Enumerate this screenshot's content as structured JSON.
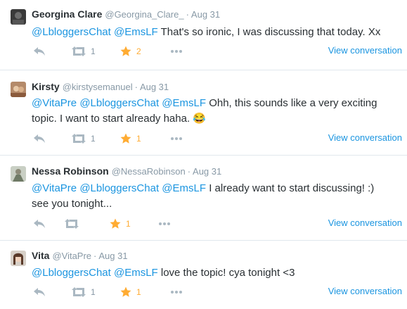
{
  "colors": {
    "link": "#1b95e0",
    "meta": "#8899a6",
    "text": "#292f33",
    "star": "#ffac33",
    "divider": "#e1e8ed"
  },
  "tweets": [
    {
      "name": "Georgina Clare",
      "handle": "@Georgina_Clare_",
      "dot": "·",
      "date": "Aug 31",
      "mentions": [
        "@LbloggersChat",
        "@EmsLF"
      ],
      "body": "That's so ironic, I was discussing that today. Xx",
      "retweets": "1",
      "favorites": "2",
      "view": "View conversation",
      "icons": {
        "reply": "reply-icon",
        "retweet": "retweet-icon",
        "favorite": "star-icon",
        "more": "more-icon"
      }
    },
    {
      "name": "Kirsty",
      "handle": "@kirstysemanuel",
      "dot": "·",
      "date": "Aug 31",
      "mentions": [
        "@VitaPre",
        "@LbloggersChat",
        "@EmsLF"
      ],
      "body_line1": "Ohh, this sounds like a very exciting",
      "body_line2": "topic. I want to start already haha. 😂",
      "retweets": "1",
      "favorites": "1",
      "view": "View conversation",
      "icons": {
        "reply": "reply-icon",
        "retweet": "retweet-icon",
        "favorite": "star-icon",
        "more": "more-icon"
      }
    },
    {
      "name": "Nessa Robinson",
      "handle": "@NessaRobinson",
      "dot": "·",
      "date": "Aug 31",
      "mentions": [
        "@VitaPre",
        "@LbloggersChat",
        "@EmsLF"
      ],
      "body_line1": "I already want to start discussing! :)",
      "body_line2": "see you tonight...",
      "favorites": "1",
      "view": "View conversation",
      "icons": {
        "reply": "reply-icon",
        "retweet": "retweet-icon",
        "favorite": "star-icon",
        "more": "more-icon"
      }
    },
    {
      "name": "Vita",
      "handle": "@VitaPre",
      "dot": "·",
      "date": "Aug 31",
      "mentions": [
        "@LbloggersChat",
        "@EmsLF"
      ],
      "body": "love the topic! cya tonight <3",
      "retweets": "1",
      "favorites": "1",
      "view": "View conversation",
      "icons": {
        "reply": "reply-icon",
        "retweet": "retweet-icon",
        "favorite": "star-icon",
        "more": "more-icon"
      }
    }
  ]
}
